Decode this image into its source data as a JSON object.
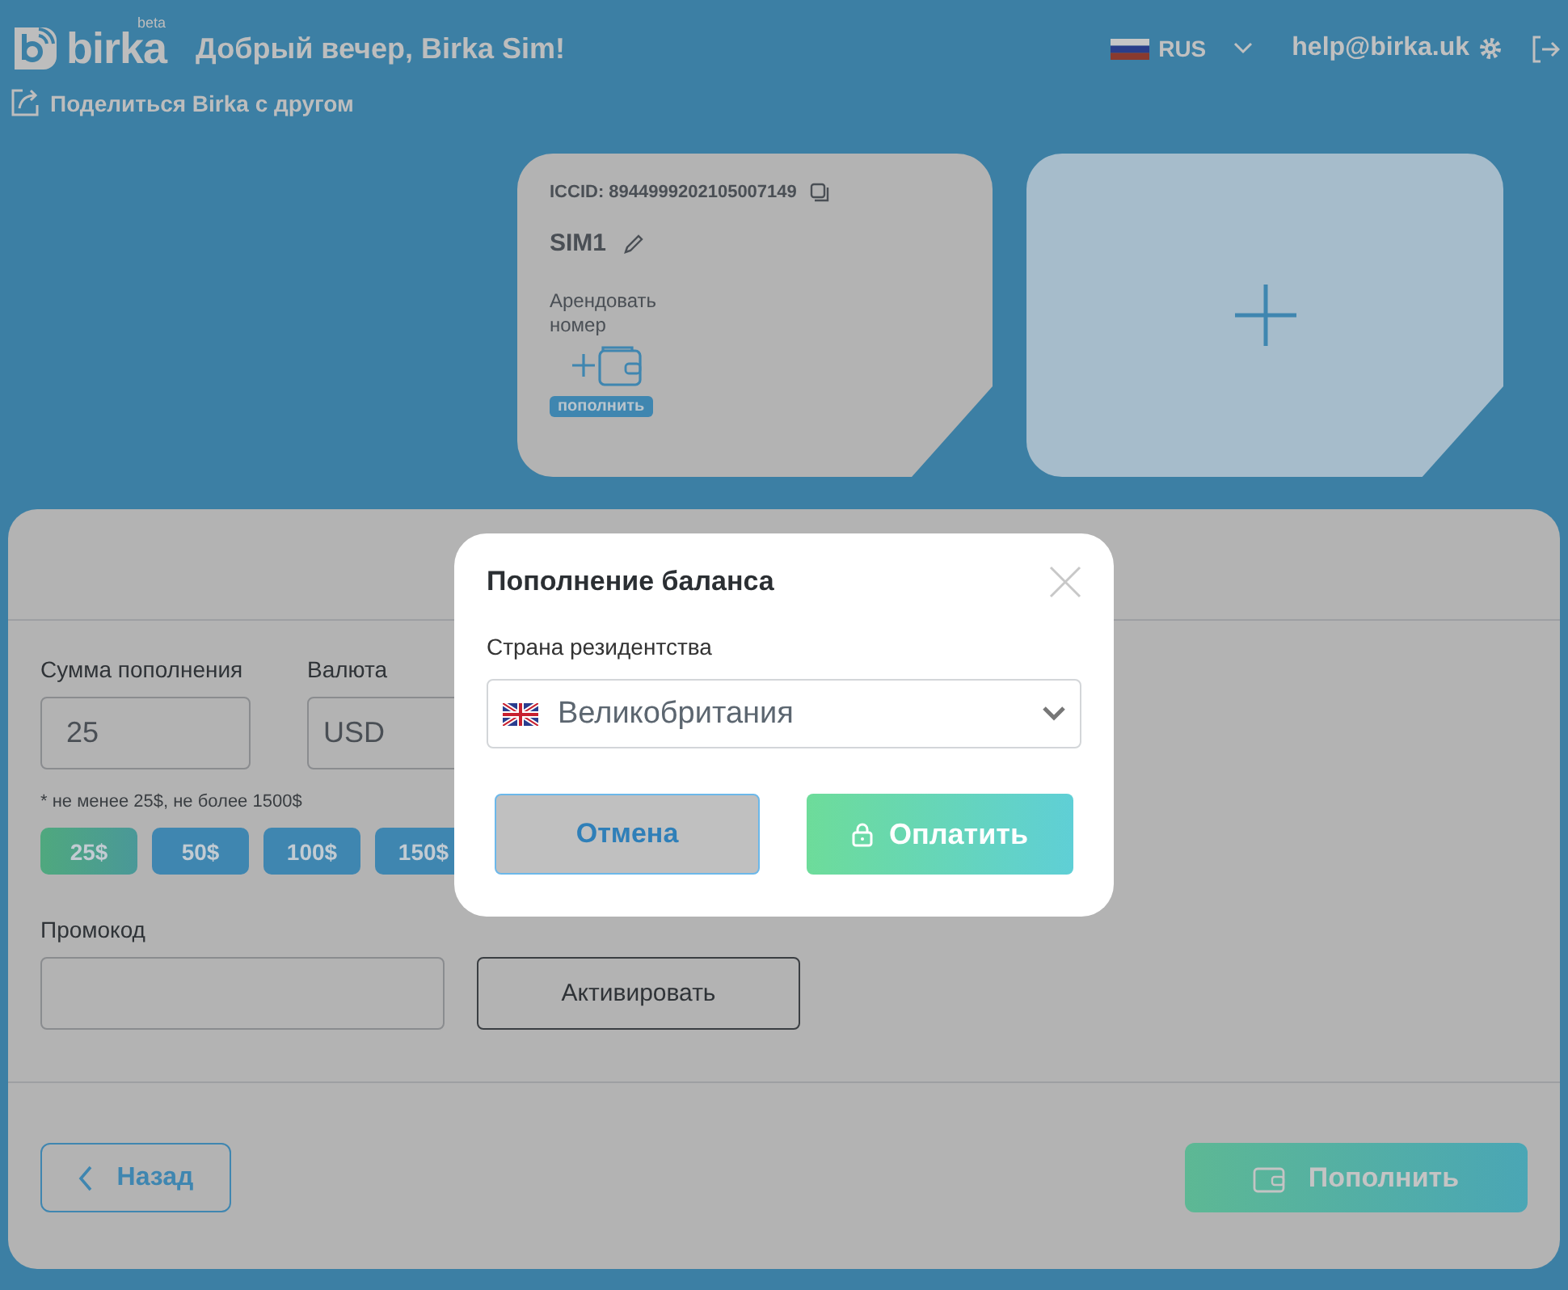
{
  "header": {
    "logo": {
      "name": "birka",
      "badge": "beta"
    },
    "greeting": "Добрый вечер, Birka Sim!",
    "share_link": "Поделиться Birka с другом",
    "language": "RUS",
    "email": "help@birka.uk"
  },
  "sim_cards": [
    {
      "kind": "sim",
      "iccid": "ICCID: 8944999202105007149",
      "name": "SIM1",
      "rent_label": "Арендовать номер",
      "topup_badge": "пополнить"
    },
    {
      "kind": "add"
    }
  ],
  "topup_form": {
    "amount_label": "Сумма пополнения",
    "amount_value": "25",
    "currency_label": "Валюта",
    "currency_value": "USD",
    "hint": "* не менее 25$, не более 1500$",
    "presets": [
      {
        "label": "25$",
        "selected": true
      },
      {
        "label": "50$",
        "selected": false
      },
      {
        "label": "100$",
        "selected": false
      },
      {
        "label": "150$",
        "selected": false
      }
    ],
    "promo_label": "Промокод",
    "activate_button": "Активировать",
    "back_button": "Назад",
    "submit_button": "Пополнить"
  },
  "modal": {
    "title": "Пополнение баланса",
    "country_label": "Страна резидентства",
    "country_value": "Великобритания",
    "cancel_button": "Отмена",
    "pay_button": "Оплатить"
  }
}
